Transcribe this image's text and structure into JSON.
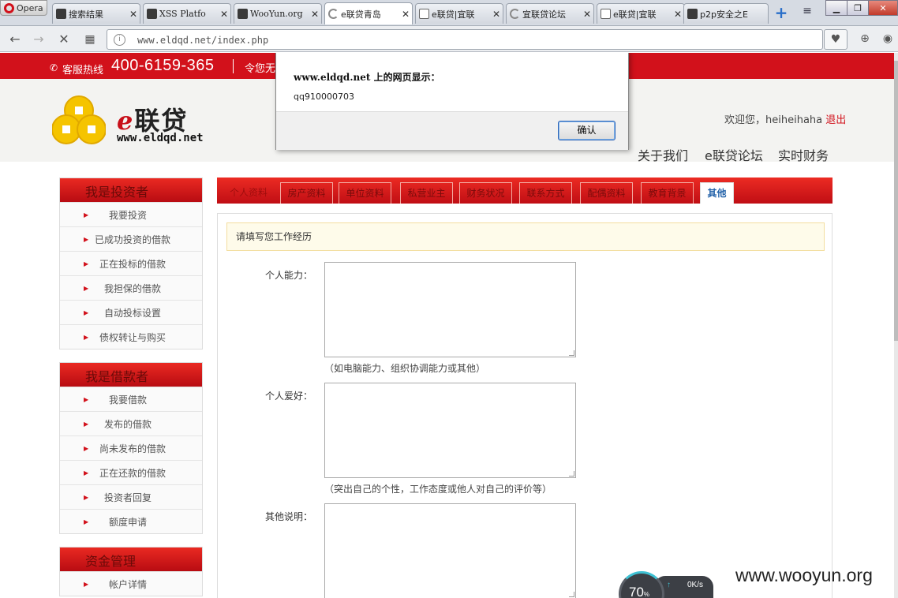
{
  "browser": {
    "menu_label": "Opera",
    "tabs": [
      {
        "title": "搜索结果",
        "favicon": "dark"
      },
      {
        "title": "XSS Platfo",
        "favicon": "dark"
      },
      {
        "title": "WooYun.org",
        "favicon": "dark"
      },
      {
        "title": "e联贷青岛",
        "favicon": "loading",
        "active": true
      },
      {
        "title": "e联贷|宜联",
        "favicon": "doc"
      },
      {
        "title": "宜联贷论坛",
        "favicon": "loading"
      },
      {
        "title": "e联贷|宜联",
        "favicon": "doc"
      },
      {
        "title": "p2p安全之E",
        "favicon": "dark"
      }
    ],
    "url": "www.eldqd.net/index.php"
  },
  "site": {
    "hotline_label": "客服热线",
    "phone": "400-6159-365",
    "notice": "令您无",
    "logo_title_e": "e",
    "logo_title_rest": "联贷",
    "logo_url": "www.eldqd.net",
    "welcome": "欢迎您，heiheihaha",
    "logout": "退出",
    "nav": [
      "关于我们",
      "e联贷论坛",
      "实时财务"
    ]
  },
  "sidebar": {
    "investor": {
      "title": "我是投资者",
      "items": [
        "我要投资",
        "已成功投资的借款",
        "正在投标的借款",
        "我担保的借款",
        "自动投标设置",
        "债权转让与购买"
      ]
    },
    "borrower": {
      "title": "我是借款者",
      "items": [
        "我要借款",
        "发布的借款",
        "尚未发布的借款",
        "正在还款的借款",
        "投资者回复",
        "额度申请"
      ]
    },
    "funds": {
      "title": "资金管理",
      "items": [
        "帐户详情"
      ]
    }
  },
  "form": {
    "tabs": [
      "个人资料",
      "房产资料",
      "单位资料",
      "私营业主",
      "财务状况",
      "联系方式",
      "配偶资料",
      "教育背景",
      "其他"
    ],
    "active_tab": "其他",
    "notice": "请填写您工作经历",
    "fields": [
      {
        "label": "个人能力：",
        "hint": "（如电脑能力、组织协调能力或其他）"
      },
      {
        "label": "个人爱好：",
        "hint": "（突出自己的个性，工作态度或他人对自己的评价等）"
      },
      {
        "label": "其他说明：",
        "hint": ""
      }
    ]
  },
  "dialog": {
    "title": "www.eldqd.net 上的网页显示：",
    "message": "qq910000703",
    "ok_label": "确认"
  },
  "overlay": {
    "percent": "70",
    "percent_unit": "%",
    "speed": "0K/s",
    "watermark": "www.wooyun.org"
  },
  "colors": {
    "brand_red": "#d2111b",
    "active_tab_text": "#2060a8"
  }
}
